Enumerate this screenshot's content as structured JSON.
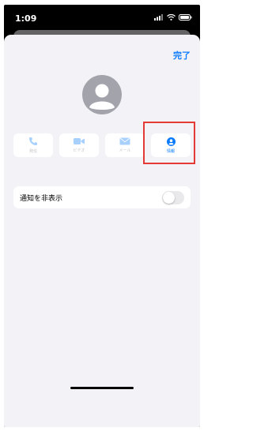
{
  "status_bar": {
    "time": "1:09",
    "icons": [
      "signal-icon",
      "wifi-icon",
      "battery-icon"
    ]
  },
  "sheet": {
    "done_label": "完了",
    "avatar_icon": "person-avatar-icon"
  },
  "actions": [
    {
      "label": "発信",
      "icon": "phone-icon",
      "enabled": false
    },
    {
      "label": "ビデオ",
      "icon": "video-icon",
      "enabled": false
    },
    {
      "label": "メール",
      "icon": "mail-icon",
      "enabled": false
    },
    {
      "label": "情報",
      "icon": "info-person-icon",
      "enabled": true,
      "highlighted": true
    }
  ],
  "settings": {
    "hide_alerts_label": "通知を非表示",
    "hide_alerts_on": false
  },
  "colors": {
    "accent": "#0a7aff",
    "highlight": "#e53935",
    "sheet_bg": "#f2f2f7"
  }
}
